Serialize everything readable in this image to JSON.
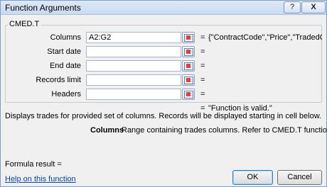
{
  "window": {
    "title": "Function Arguments",
    "help_label": "?",
    "close_label": "X"
  },
  "function_group": {
    "name": "CMED.T",
    "arguments": [
      {
        "label": "Columns",
        "value": "A2:G2",
        "equals": "=",
        "result": "{\"ContractCode\",\"Price\",\"TradedQua..."
      },
      {
        "label": "Start date",
        "value": "",
        "equals": "=",
        "result": ""
      },
      {
        "label": "End date",
        "value": "",
        "equals": "=",
        "result": ""
      },
      {
        "label": "Records limit",
        "value": "",
        "equals": "=",
        "result": ""
      },
      {
        "label": "Headers",
        "value": "",
        "equals": "=",
        "result": ""
      }
    ]
  },
  "validity": {
    "equals": "=",
    "text": "\"Function is valid.\""
  },
  "description": "Displays trades for provided set of columns. Records will be displayed starting in cell below.",
  "argument_help": {
    "name": "Columns",
    "text": "Range containing trades columns. Refer to CMED.T function."
  },
  "formula_result": {
    "label": "Formula result ="
  },
  "footer": {
    "help_link": "Help on this function",
    "ok_label": "OK",
    "cancel_label": "Cancel"
  }
}
